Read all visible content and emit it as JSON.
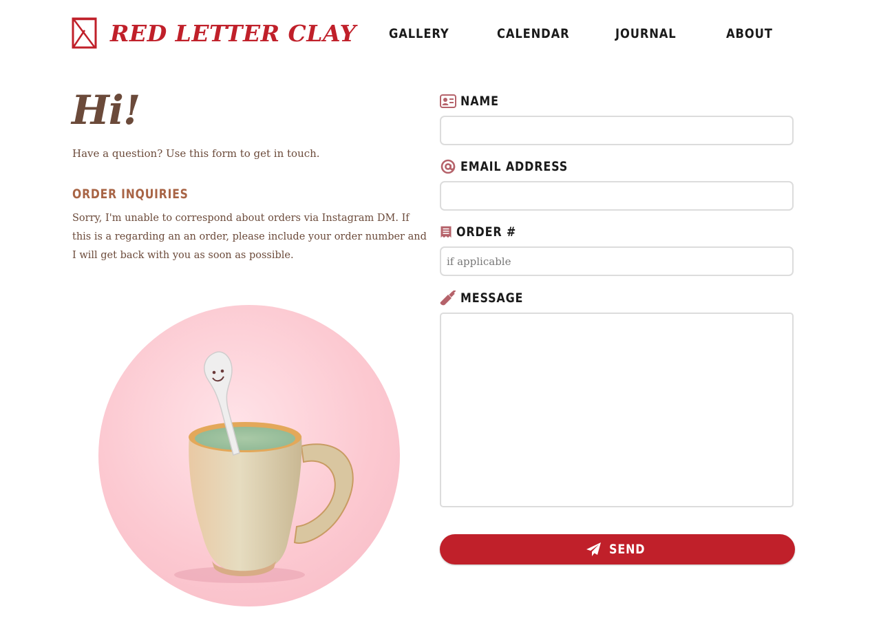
{
  "brand": {
    "name": "RED LETTER CLAY",
    "accent_color": "#c0202a",
    "logo_icon": "envelope-logo-icon"
  },
  "nav": {
    "items": [
      {
        "label": "GALLERY"
      },
      {
        "label": "CALENDAR"
      },
      {
        "label": "JOURNAL"
      },
      {
        "label": "ABOUT"
      }
    ]
  },
  "intro": {
    "greeting": "Hi!",
    "text": "Have a question? Use this form to get in touch."
  },
  "order_inquiries": {
    "heading": "ORDER INQUIRIES",
    "body": "Sorry, I'm unable to correspond about orders via Instagram DM. If this is a regarding an an order, please include your order number and I will get back with you as soon as possible."
  },
  "photo": {
    "subject": "ceramic mug with spoon on pink background"
  },
  "form": {
    "name": {
      "label": "NAME",
      "icon": "id-card-icon",
      "value": "",
      "placeholder": ""
    },
    "email": {
      "label": "EMAIL ADDRESS",
      "icon": "at-sign-icon",
      "value": "",
      "placeholder": ""
    },
    "order": {
      "label": "ORDER #",
      "icon": "receipt-icon",
      "value": "",
      "placeholder": "if applicable"
    },
    "message": {
      "label": "MESSAGE",
      "icon": "bottle-icon",
      "value": "",
      "placeholder": ""
    },
    "submit": {
      "label": "SEND",
      "icon": "paper-plane-icon"
    }
  },
  "colors": {
    "label_icon": "#b5626a",
    "body_text": "#6b4a3a",
    "section_heading": "#a86445"
  }
}
